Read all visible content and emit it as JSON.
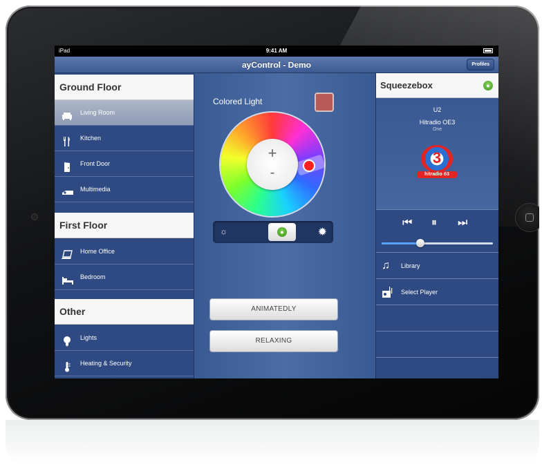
{
  "status_bar": {
    "carrier": "iPad",
    "time": "9:41 AM"
  },
  "nav": {
    "title": "ayControl - Demo",
    "profiles_label": "Profiles"
  },
  "sidebar": {
    "sections": [
      {
        "title": "Ground Floor",
        "items": [
          {
            "label": "Living Room",
            "icon": "sofa-icon",
            "selected": true
          },
          {
            "label": "Kitchen",
            "icon": "fork-knife-icon",
            "selected": false
          },
          {
            "label": "Front Door",
            "icon": "door-icon",
            "selected": false
          },
          {
            "label": "Multimedia",
            "icon": "projector-icon",
            "selected": false
          }
        ]
      },
      {
        "title": "First Floor",
        "items": [
          {
            "label": "Home Office",
            "icon": "laptop-icon",
            "selected": false
          },
          {
            "label": "Bedroom",
            "icon": "bed-icon",
            "selected": false
          }
        ]
      },
      {
        "title": "Other",
        "items": [
          {
            "label": "Lights",
            "icon": "lightbulb-icon",
            "selected": false
          },
          {
            "label": "Heating & Security",
            "icon": "thermometer-icon",
            "selected": false
          }
        ]
      }
    ]
  },
  "light_control": {
    "label": "Colored Light",
    "color_swatch": "#b95a5a",
    "wheel_plus": "+",
    "wheel_minus": "-",
    "brightness_level": 0.6
  },
  "scenes": [
    {
      "label": "ANIMATEDLY"
    },
    {
      "label": "RELAXING"
    }
  ],
  "player": {
    "title": "Squeezebox",
    "artist": "U2",
    "station": "Hitradio OE3",
    "subtitle": "One",
    "logo_text": "hitradio ö3",
    "volume": 0.35,
    "items": [
      {
        "label": "Library",
        "icon": "music-note-icon"
      },
      {
        "label": "Select Player",
        "icon": "speaker-icon"
      }
    ]
  },
  "colors": {
    "panel_blue": "#2f4a82",
    "header_white": "#f6f6f6",
    "accent_green": "#3d9423"
  }
}
